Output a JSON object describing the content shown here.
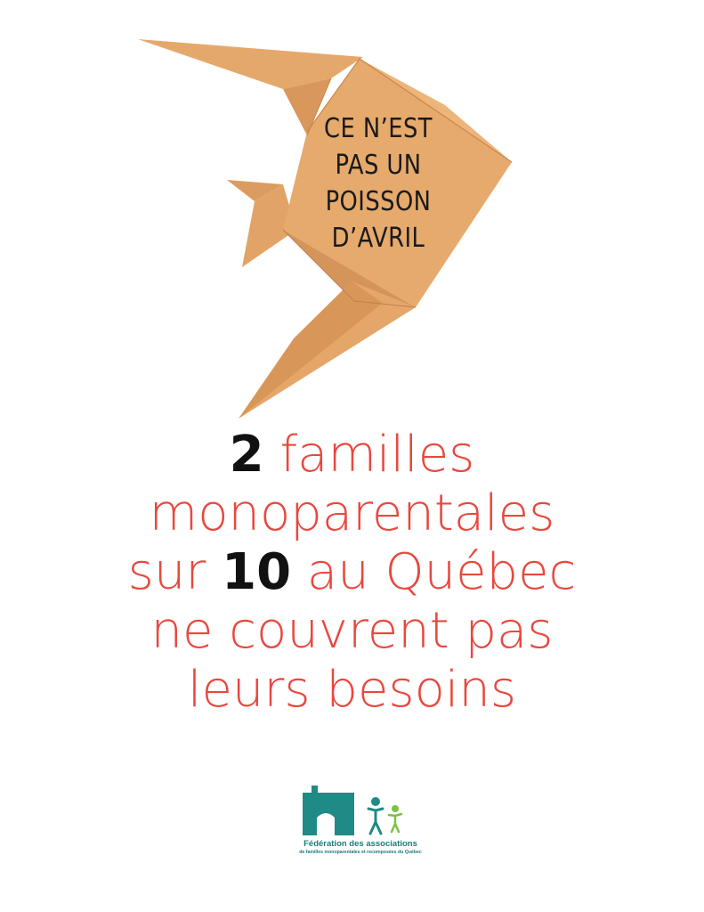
{
  "fish": {
    "lines": [
      "CE N’EST",
      "PAS UN",
      "POISSON",
      "D’AVRIL"
    ]
  },
  "headline": {
    "line1_num": "2",
    "line1_rest": " familles",
    "line2": "monoparentales",
    "line3_pre": "sur ",
    "line3_num": "10",
    "line3_post": " au Québec",
    "line4": "ne couvrent pas",
    "line5": "leurs besoins"
  },
  "logo": {
    "line1": "Fédération des associations",
    "line2": "de familles monoparentales et recomposées du Québec"
  },
  "colors": {
    "headline": "#e8483f",
    "numbers": "#111111",
    "fish": "#e3a567",
    "logo": "#1f7a78"
  }
}
